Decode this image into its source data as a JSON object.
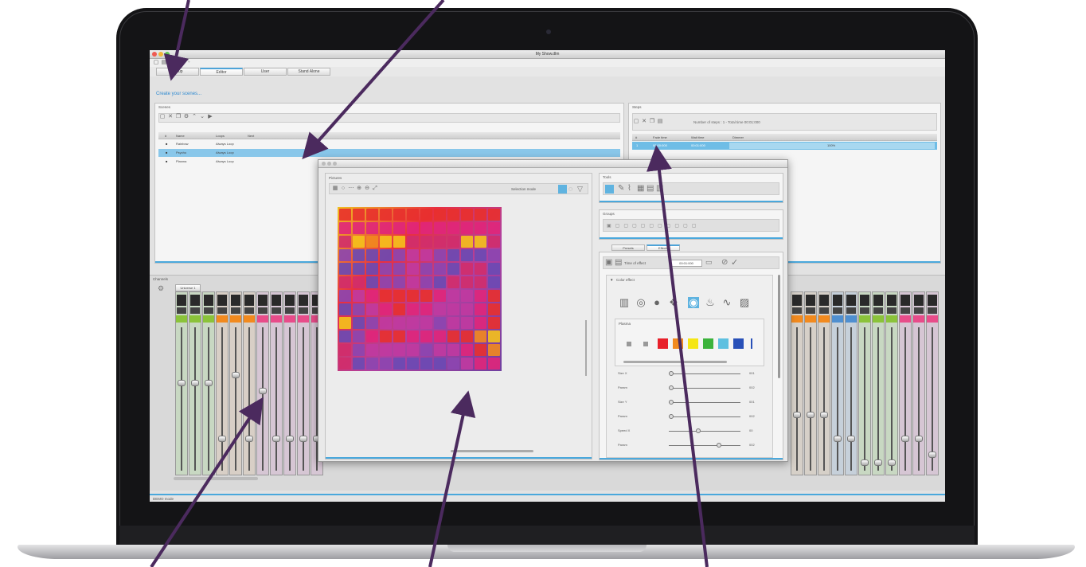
{
  "window": {
    "title": "My Show.dlm"
  },
  "tabs": [
    {
      "label": "Setup"
    },
    {
      "label": "Editor"
    },
    {
      "label": "User"
    },
    {
      "label": "Stand Alone"
    }
  ],
  "subtitle": "Create your scenes...",
  "scenes": {
    "title": "Scenes",
    "columns": [
      "#",
      "Name",
      "Loops",
      "Next"
    ],
    "rows": [
      {
        "name": "Rainbow",
        "loops": "Always Loop"
      },
      {
        "name": "Psycho",
        "loops": "Always Loop"
      },
      {
        "name": "Plasma",
        "loops": "Always Loop"
      }
    ]
  },
  "steps": {
    "title": "Steps",
    "info": "Number of steps : 1 - Total time 00:01:000",
    "columns": [
      "#",
      "Fade time",
      "Wait time",
      "Dimmer"
    ],
    "row": {
      "index": "1",
      "fade": "00:00:000",
      "wait": "00:01:000",
      "dimmer": "100%"
    }
  },
  "channels": {
    "title": "Channels",
    "universe_tab": "Universe 1"
  },
  "popup": {
    "pictures_title": "Pictures",
    "selection_mode_label": "Selection mode",
    "tools_title": "Tools",
    "groups_title": "Groups",
    "subtabs": [
      "Presets",
      "Effects"
    ],
    "time_of_effect_label": "Time of effect",
    "time_of_effect_value": "00:01:000",
    "color_effect_label": "Color effect",
    "plasma_title": "Plasma",
    "sliders": [
      {
        "name": "Size X",
        "value": "001"
      },
      {
        "name": "Param",
        "value": "002"
      },
      {
        "name": "Size Y",
        "value": "001"
      },
      {
        "name": "Param",
        "value": "002"
      },
      {
        "name": "Speed X",
        "value": "00"
      },
      {
        "name": "Param",
        "value": "002"
      }
    ]
  },
  "status": {
    "text": "DEMO mode"
  },
  "colors": {
    "accent": "#4aa8dc",
    "selection": "#89c7ea",
    "arrow": "#4b2a5e",
    "plasma_swatches": [
      "#e8202a",
      "#f28a1e",
      "#f5e614",
      "#3cb33c",
      "#5ec0e0",
      "#2850b8"
    ]
  },
  "icons": [
    "new-icon",
    "open-icon",
    "save-icon",
    "undo-icon",
    "redo-icon",
    "delete-icon",
    "copy-icon",
    "play-icon",
    "zoom-in-icon",
    "zoom-out-icon",
    "fit-icon",
    "pencil-icon",
    "fire-icon",
    "image-icon",
    "check-icon"
  ]
}
